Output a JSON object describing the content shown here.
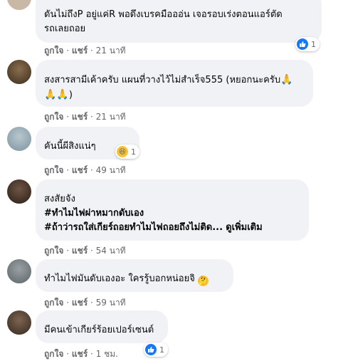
{
  "comments": [
    {
      "text": "ดันไม่ถึงP อยู่แค่R พอดึงเบรคมือออ่น เจอรอบเร่งตอนแอร์ตัด\nรถเลยถอย",
      "like_label": "ถูกใจ",
      "reply_label": "แชร์",
      "time": "21 นาที",
      "reaction_count": "1",
      "reaction_icon": "like-icon"
    },
    {
      "text": "สงสารสามีเค้าครับ แผนที่วางไว้ไม่สำเร็จ555 (หยอกนะครับ",
      "text2": ")",
      "like_label": "ถูกใจ",
      "reply_label": "แชร์",
      "time": "21 นาที"
    },
    {
      "text": "คันนี้ผีสิงแน่ๆ",
      "like_label": "ถูกใจ",
      "reply_label": "แชร์",
      "time": "49 นาที",
      "reaction_count": "1",
      "reaction_icon": "haha-icon"
    },
    {
      "line1": "สงสัยจัง",
      "line2": "#ทำไมไฟผ่าหมากดับเอง",
      "line3": "#ถ้าว่ารถใส่เกียร์ถอยทำไมไฟถอยถึงไม่ติด...",
      "see_more": "ดูเพิ่มเติม",
      "like_label": "ถูกใจ",
      "reply_label": "แชร์",
      "time": "54 นาที"
    },
    {
      "text": "ทำไมไฟมันดับเองอะ ใครรู้บอกหน่อยจิ",
      "like_label": "ถูกใจ",
      "reply_label": "แชร์",
      "time": "59 นาที"
    },
    {
      "text": "มีคนเข้าเกียร์ร้อยเปอร์เซนต์",
      "like_label": "ถูกใจ",
      "reply_label": "แชร์",
      "time": "1 ชม.",
      "reaction_count": "1",
      "reaction_icon": "like-icon"
    }
  ],
  "separator": " · ",
  "colors": {
    "bubble": "#f0f2f5",
    "meta": "#65676b",
    "like": "#1877f2"
  }
}
